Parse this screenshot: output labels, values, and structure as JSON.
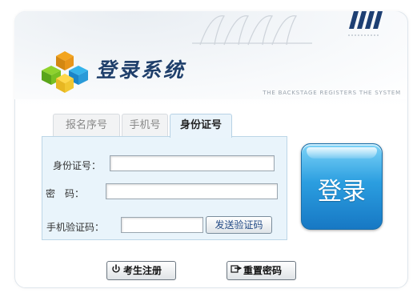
{
  "header": {
    "app_title": "登录系统",
    "tagline": "THE BACKSTAGE REGISTERS THE SYSTEM"
  },
  "tabs": [
    {
      "label": "报名序号",
      "active": false
    },
    {
      "label": "手机号",
      "active": false
    },
    {
      "label": "身份证号",
      "active": true
    }
  ],
  "form": {
    "id_label": "身份证号：",
    "id_value": "",
    "password_label": "密　码：",
    "password_value": "",
    "sms_label": "手机验证码：",
    "sms_value": "",
    "send_code_label": "发送验证码"
  },
  "login_button": {
    "label": "登录"
  },
  "footer": {
    "register_label": "考生注册",
    "register_icon": "power-icon",
    "reset_label": "重置密码",
    "reset_icon": "hand-pointer-icon"
  },
  "colors": {
    "title": "#1f3f6b",
    "login_button": "#2b9ee0",
    "form_bg": "#e9f4fb",
    "send_code_text": "#244b86"
  }
}
